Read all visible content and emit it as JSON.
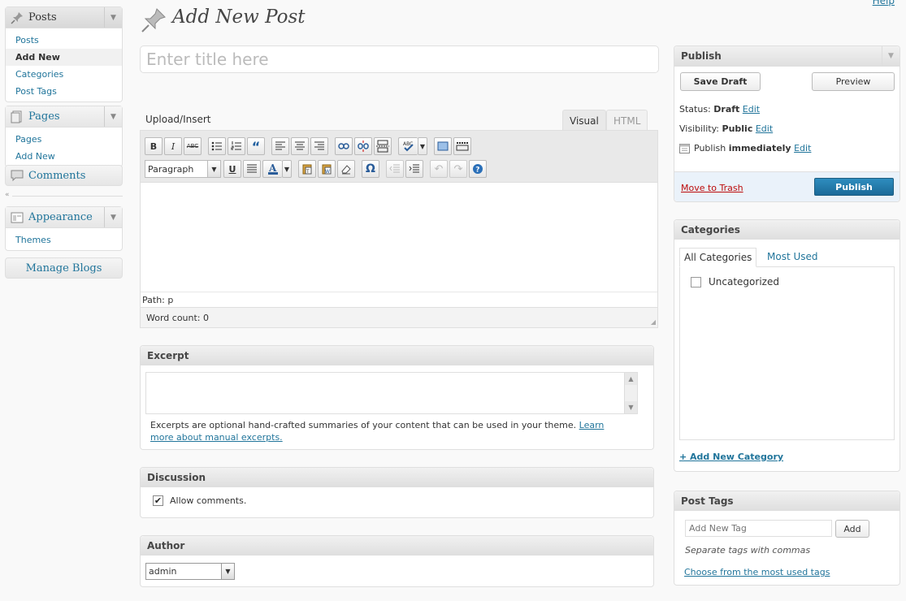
{
  "menu": {
    "posts": {
      "label": "Posts",
      "items": [
        {
          "label": "Posts"
        },
        {
          "label": "Add New"
        },
        {
          "label": "Categories"
        },
        {
          "label": "Post Tags"
        }
      ]
    },
    "pages": {
      "label": "Pages",
      "items": [
        {
          "label": "Pages"
        },
        {
          "label": "Add New"
        }
      ]
    },
    "comments": {
      "label": "Comments"
    },
    "appearance": {
      "label": "Appearance",
      "items": [
        {
          "label": "Themes"
        }
      ]
    },
    "manage_blogs": {
      "label": "Manage Blogs"
    }
  },
  "header": {
    "title": "Add New Post",
    "help": "Help"
  },
  "editor": {
    "title_placeholder": "Enter title here",
    "upload_insert": "Upload/Insert",
    "tab_visual": "Visual",
    "tab_html": "HTML",
    "format_select": "Paragraph",
    "path": "Path: p",
    "word_count": "Word count: 0"
  },
  "excerpt": {
    "heading": "Excerpt",
    "help_text": "Excerpts are optional hand-crafted summaries of your content that can be used in your theme.",
    "learn_more": "Learn more about manual excerpts."
  },
  "discussion": {
    "heading": "Discussion",
    "allow_comments": "Allow comments."
  },
  "author": {
    "heading": "Author",
    "selected": "admin"
  },
  "publish": {
    "heading": "Publish",
    "save_draft": "Save Draft",
    "preview": "Preview",
    "status_label": "Status:",
    "status_value": "Draft",
    "visibility_label": "Visibility:",
    "visibility_value": "Public",
    "publish_label": "Publish",
    "publish_value": "immediately",
    "edit": "Edit",
    "move_to_trash": "Move to Trash",
    "publish_button": "Publish"
  },
  "categories": {
    "heading": "Categories",
    "tab_all": "All Categories",
    "tab_most_used": "Most Used",
    "items": [
      {
        "label": "Uncategorized",
        "checked": false
      }
    ],
    "add_new": "+ Add New Category"
  },
  "post_tags": {
    "heading": "Post Tags",
    "input_placeholder": "Add New Tag",
    "add_button": "Add",
    "hint": "Separate tags with commas",
    "choose_link": "Choose from the most used tags"
  }
}
